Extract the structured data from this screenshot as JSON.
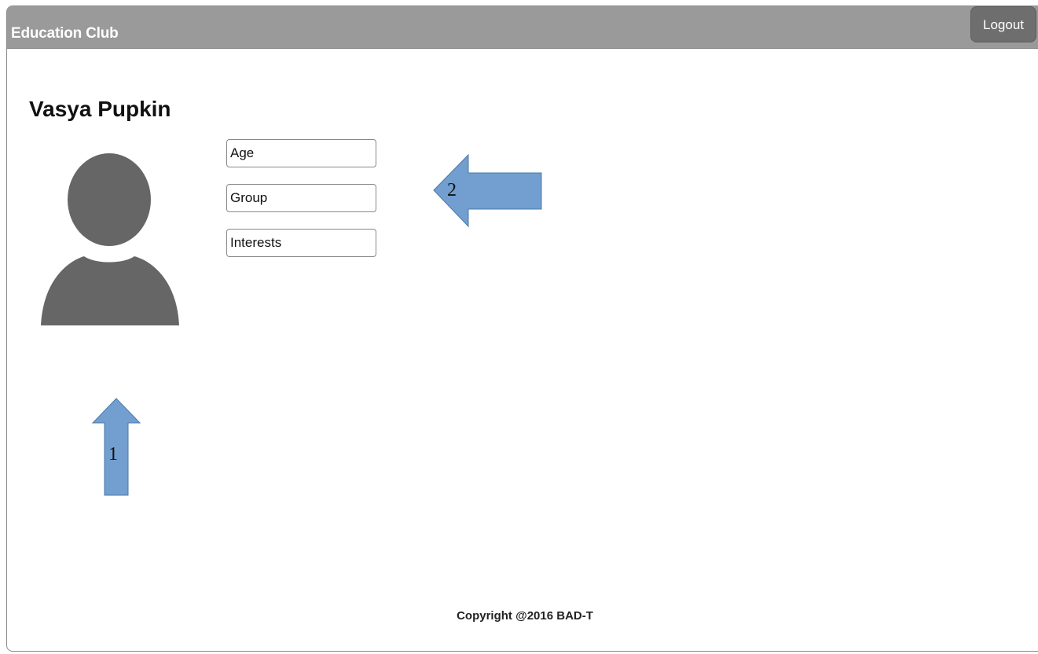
{
  "header": {
    "title": "Education Club",
    "logout_label": "Logout"
  },
  "profile": {
    "name": "Vasya Pupkin",
    "fields": {
      "age": {
        "placeholder": "Age",
        "value": ""
      },
      "group": {
        "placeholder": "Group",
        "value": ""
      },
      "interests": {
        "placeholder": "Interests",
        "value": ""
      }
    }
  },
  "annotations": {
    "arrow_1_label": "1",
    "arrow_2_label": "2",
    "arrow_color": "#729fcf",
    "arrow_stroke": "#4a78a8"
  },
  "footer": {
    "copyright": "Copyright @2016 BAD-T"
  },
  "colors": {
    "header_bg": "#9a9a9a",
    "logout_bg": "#6e6e6e",
    "avatar": "#666666"
  }
}
